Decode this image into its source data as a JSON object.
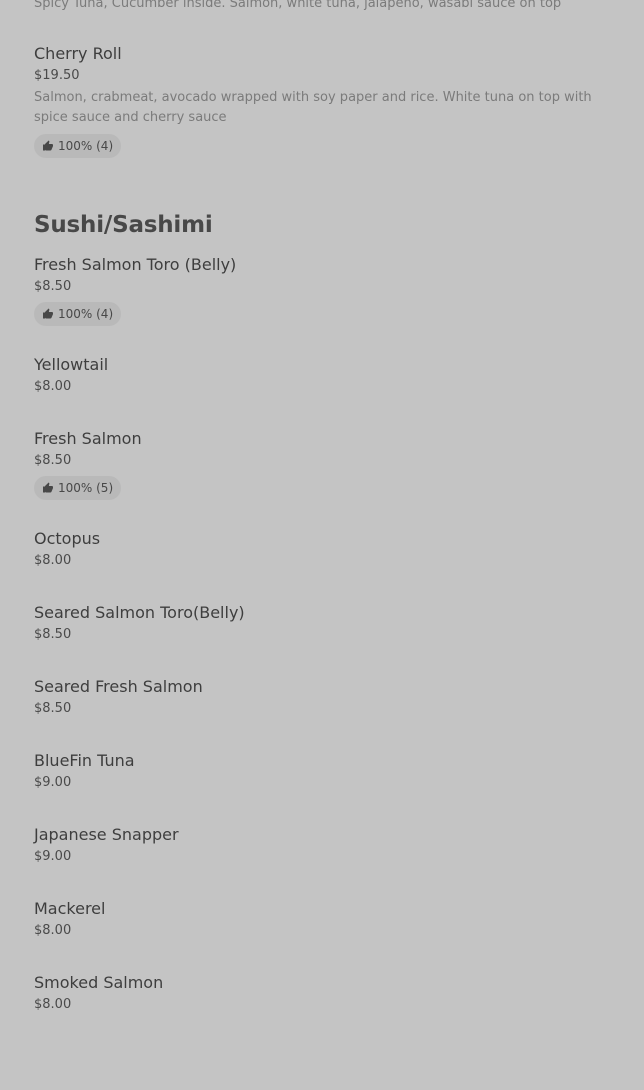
{
  "top_description": "Spicy Tuna, Cucumber inside. Salmon, white tuna, jalapeno, wasabi sauce on top",
  "cherry_roll": {
    "name": "Cherry Roll",
    "price": "$19.50",
    "description": "Salmon, crabmeat, avocado wrapped with soy paper and rice. White tuna on top with spice sauce and cherry sauce",
    "rating": "100% (4)"
  },
  "section": {
    "title": "Sushi/Sashimi",
    "items": [
      {
        "name": "Fresh Salmon Toro (Belly)",
        "price": "$8.50",
        "rating": "100% (4)"
      },
      {
        "name": "Yellowtail",
        "price": "$8.00"
      },
      {
        "name": "Fresh Salmon",
        "price": "$8.50",
        "rating": "100% (5)"
      },
      {
        "name": "Octopus",
        "price": "$8.00"
      },
      {
        "name": "Seared Salmon Toro(Belly)",
        "price": "$8.50"
      },
      {
        "name": "Seared Fresh Salmon",
        "price": "$8.50"
      },
      {
        "name": "BlueFin Tuna",
        "price": "$9.00"
      },
      {
        "name": "Japanese Snapper",
        "price": "$9.00"
      },
      {
        "name": "Mackerel",
        "price": "$8.00"
      },
      {
        "name": "Smoked Salmon",
        "price": "$8.00"
      }
    ]
  },
  "icons": {
    "rating_icon": "thumbs-up-icon"
  }
}
